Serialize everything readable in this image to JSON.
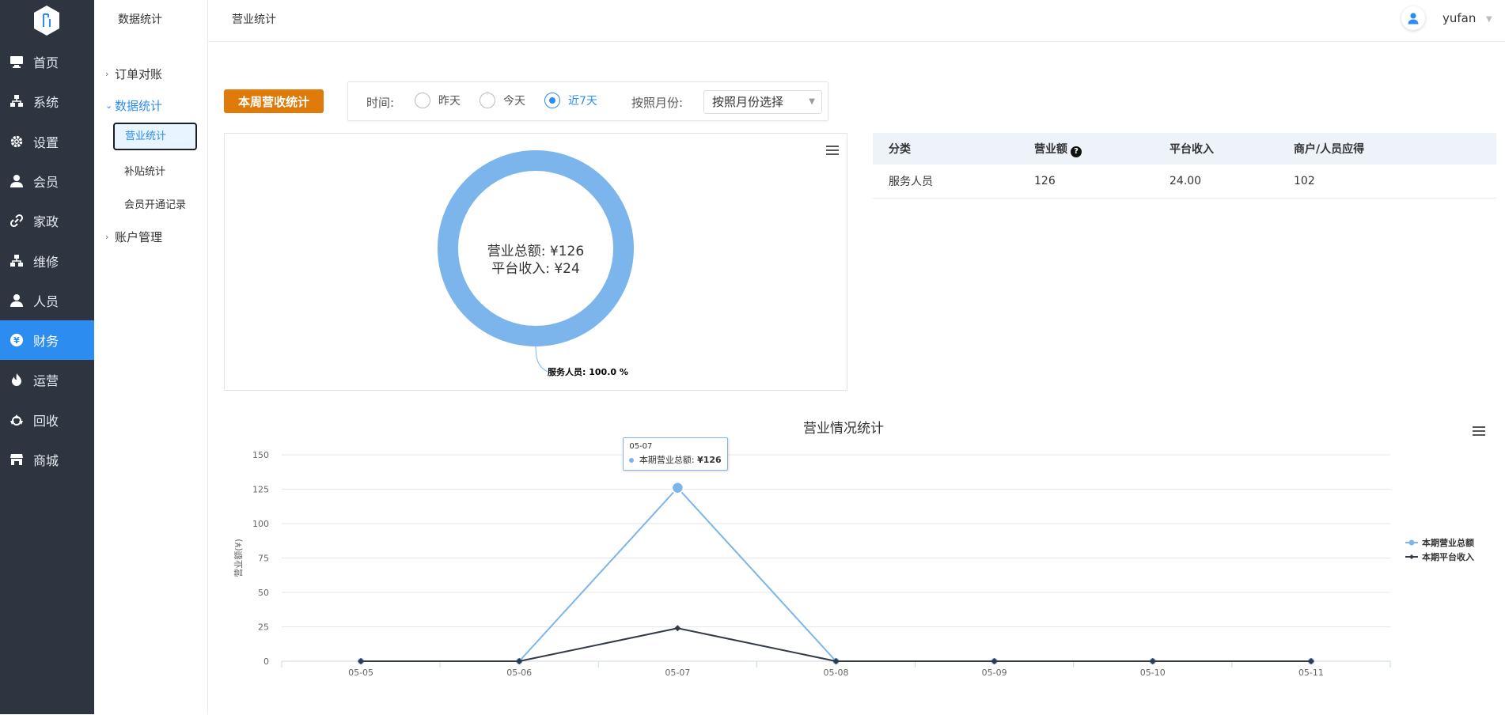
{
  "sidebar": {
    "items": [
      {
        "label": "首页",
        "icon": "monitor-icon"
      },
      {
        "label": "系统",
        "icon": "sitemap-icon"
      },
      {
        "label": "设置",
        "icon": "gear-icon"
      },
      {
        "label": "会员",
        "icon": "user-icon"
      },
      {
        "label": "家政",
        "icon": "link-icon"
      },
      {
        "label": "维修",
        "icon": "sitemap-icon"
      },
      {
        "label": "人员",
        "icon": "user-icon"
      },
      {
        "label": "财务",
        "icon": "yen-icon",
        "active": true
      },
      {
        "label": "运营",
        "icon": "flame-icon"
      },
      {
        "label": "回收",
        "icon": "recycle-icon"
      },
      {
        "label": "商城",
        "icon": "store-icon"
      }
    ],
    "accent": "#2d8cf0"
  },
  "submenu": {
    "title": "数据统计",
    "groups": [
      {
        "label": "订单对账"
      },
      {
        "label": "数据统计",
        "open": true,
        "items": [
          "营业统计",
          "补贴统计",
          "会员开通记录"
        ]
      },
      {
        "label": "账户管理"
      }
    ]
  },
  "header": {
    "breadcrumb": "营业统计",
    "username": "yufan"
  },
  "filters": {
    "tag_label": "本周营收统计",
    "time_label": "时间:",
    "options": [
      {
        "label": "昨天",
        "checked": false
      },
      {
        "label": "今天",
        "checked": false
      },
      {
        "label": "近7天",
        "checked": true
      }
    ],
    "month_label": "按照月份:",
    "month_select": "按照月份选择"
  },
  "donut": {
    "center_line1": "营业总额: ¥126",
    "center_line2": "平台收入: ¥24",
    "slice_label": "服务人员: 100.0 %",
    "slices": [
      {
        "name": "服务人员",
        "percent": 100.0,
        "color": "#7cb5ec"
      }
    ]
  },
  "table": {
    "headers": [
      "分类",
      "营业额",
      "平台收入",
      "商户/人员应得"
    ],
    "rows": [
      [
        "服务人员",
        "126",
        "24.00",
        "102"
      ]
    ]
  },
  "chart_data": {
    "type": "line",
    "title": "营业情况统计",
    "ylabel": "营业额(¥)",
    "xlabel": "",
    "categories": [
      "05-05",
      "05-06",
      "05-07",
      "05-08",
      "05-09",
      "05-10",
      "05-11"
    ],
    "yticks": [
      0,
      25,
      50,
      75,
      100,
      125,
      150
    ],
    "ylim": [
      0,
      150
    ],
    "grid": true,
    "legend": "right",
    "series": [
      {
        "name": "本期营业总额",
        "color": "#7cb5ec",
        "values": [
          0,
          0,
          126,
          0,
          0,
          0,
          0
        ]
      },
      {
        "name": "本期平台收入",
        "color": "#333a45",
        "values": [
          0,
          0,
          24,
          0,
          0,
          0,
          0
        ]
      }
    ],
    "tooltip": {
      "x": "05-07",
      "label": "本期营业总额:",
      "value": "¥126"
    }
  }
}
